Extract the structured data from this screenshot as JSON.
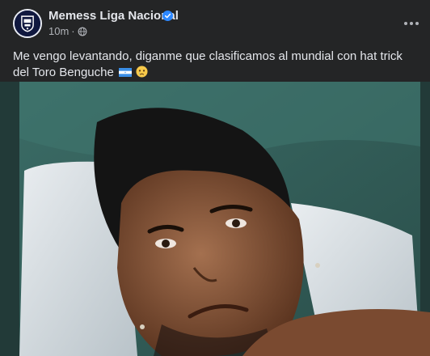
{
  "post": {
    "page_name": "Memess Liga Nacional",
    "timestamp": "10m",
    "separator": "·",
    "privacy_icon": "globe-icon",
    "verified_icon": "verified-badge-icon",
    "more_icon": "more-options-icon",
    "caption": "Me vengo levantando, diganme que clasificamos al mundial con hat trick del Toro Benguche",
    "caption_emojis": [
      "honduras-flag",
      "crying-face"
    ]
  },
  "colors": {
    "background": "#242526",
    "text_primary": "#e4e6eb",
    "text_secondary": "#b0b3b8",
    "verified": "#2d88ff"
  }
}
